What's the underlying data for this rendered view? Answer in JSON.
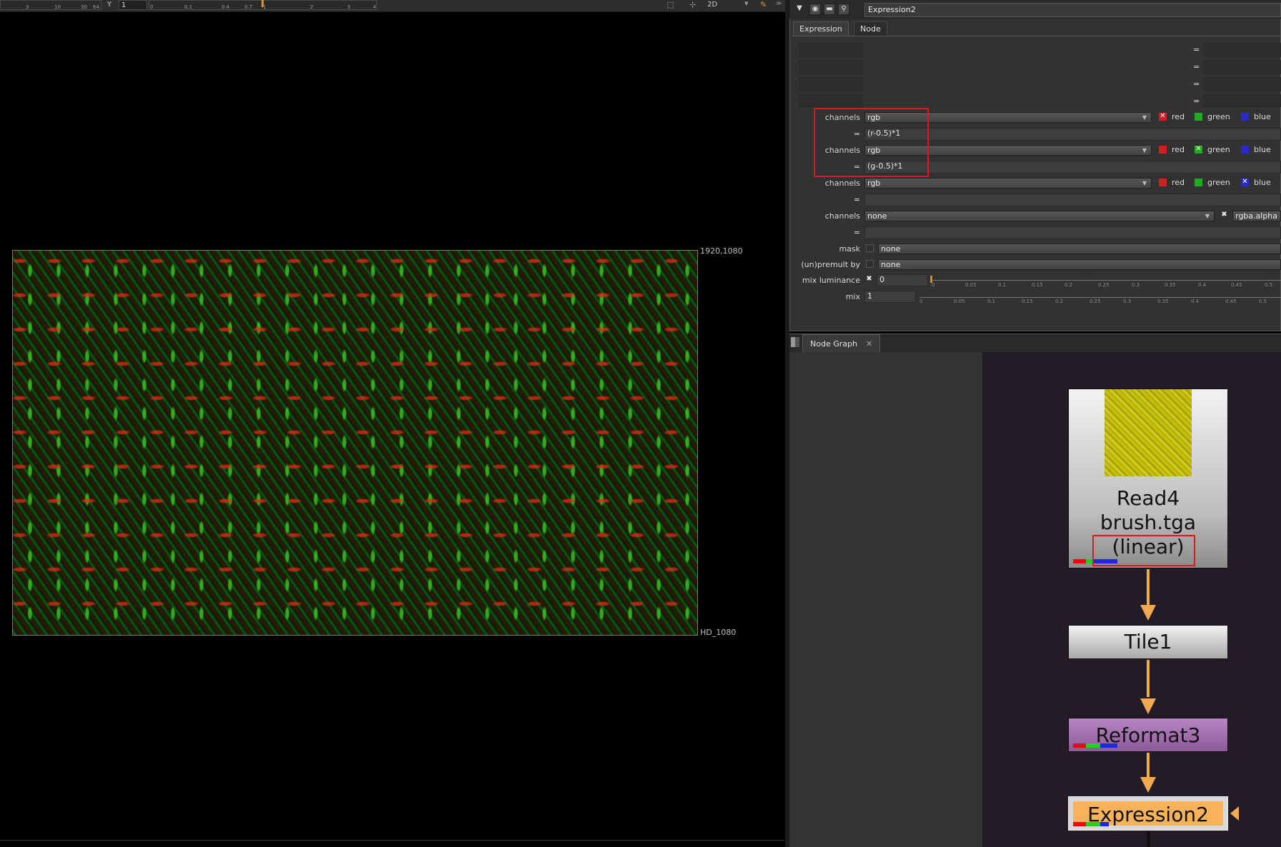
{
  "viewer": {
    "toolbar": {
      "ruler1_ticks": [
        "3",
        "10",
        "30",
        "64"
      ],
      "y_label": "Y",
      "y_value": "1",
      "ruler2_ticks": [
        "0",
        "0.1",
        "0.4",
        "0.7",
        "1",
        "2",
        "3",
        "4"
      ],
      "view_mode": "2D"
    },
    "format_res_label": "1920,1080",
    "format_name_label": "HD_1080"
  },
  "properties": {
    "node_name": "Expression2",
    "tabs": [
      "Expression",
      "Node"
    ],
    "rows": [
      {
        "label": "channels",
        "value": "rgb",
        "checks": [
          {
            "name": "red",
            "checked": true,
            "color": "#cc2222"
          },
          {
            "name": "green",
            "checked": false,
            "color": "#22aa22"
          },
          {
            "name": "blue",
            "checked": false,
            "color": "#2a2acc"
          }
        ]
      },
      {
        "label": "=",
        "value": "(r-0.5)*1"
      },
      {
        "label": "channels",
        "value": "rgb",
        "checks": [
          {
            "name": "red",
            "checked": false,
            "color": "#cc2222"
          },
          {
            "name": "green",
            "checked": true,
            "color": "#22aa22"
          },
          {
            "name": "blue",
            "checked": false,
            "color": "#2a2acc"
          }
        ]
      },
      {
        "label": "=",
        "value": "(g-0.5)*1"
      },
      {
        "label": "channels",
        "value": "rgb",
        "checks": [
          {
            "name": "red",
            "checked": false,
            "color": "#cc2222"
          },
          {
            "name": "green",
            "checked": false,
            "color": "#22aa22"
          },
          {
            "name": "blue",
            "checked": true,
            "color": "#2a2acc"
          }
        ]
      },
      {
        "label": "=",
        "value": ""
      },
      {
        "label": "channels",
        "value": "none",
        "extra": "rgba.alpha"
      },
      {
        "label": "=",
        "value": ""
      }
    ],
    "mask": {
      "label": "mask",
      "value": "none"
    },
    "premult": {
      "label": "(un)premult by",
      "value": "none"
    },
    "mix_luminance": {
      "label": "mix luminance",
      "value": "0"
    },
    "mix": {
      "label": "mix",
      "value": "1"
    },
    "slider_ticks": [
      "0",
      "0.05",
      "0.1",
      "0.15",
      "0.2",
      "0.25",
      "0.3",
      "0.35",
      "0.4",
      "0.45",
      "0.5"
    ]
  },
  "node_graph": {
    "tab_label": "Node Graph",
    "nodes": {
      "read": {
        "line1": "Read4",
        "line2": "brush.tga",
        "line3": "(linear)"
      },
      "tile": {
        "label": "Tile1"
      },
      "reformat": {
        "label": "Reformat3"
      },
      "expression": {
        "label": "Expression2"
      }
    },
    "colors": {
      "arrow": "#f3a94f",
      "reformat": "#9b66a6",
      "expression": "#f7b25a",
      "read_thumb": "#c4c10e"
    }
  }
}
